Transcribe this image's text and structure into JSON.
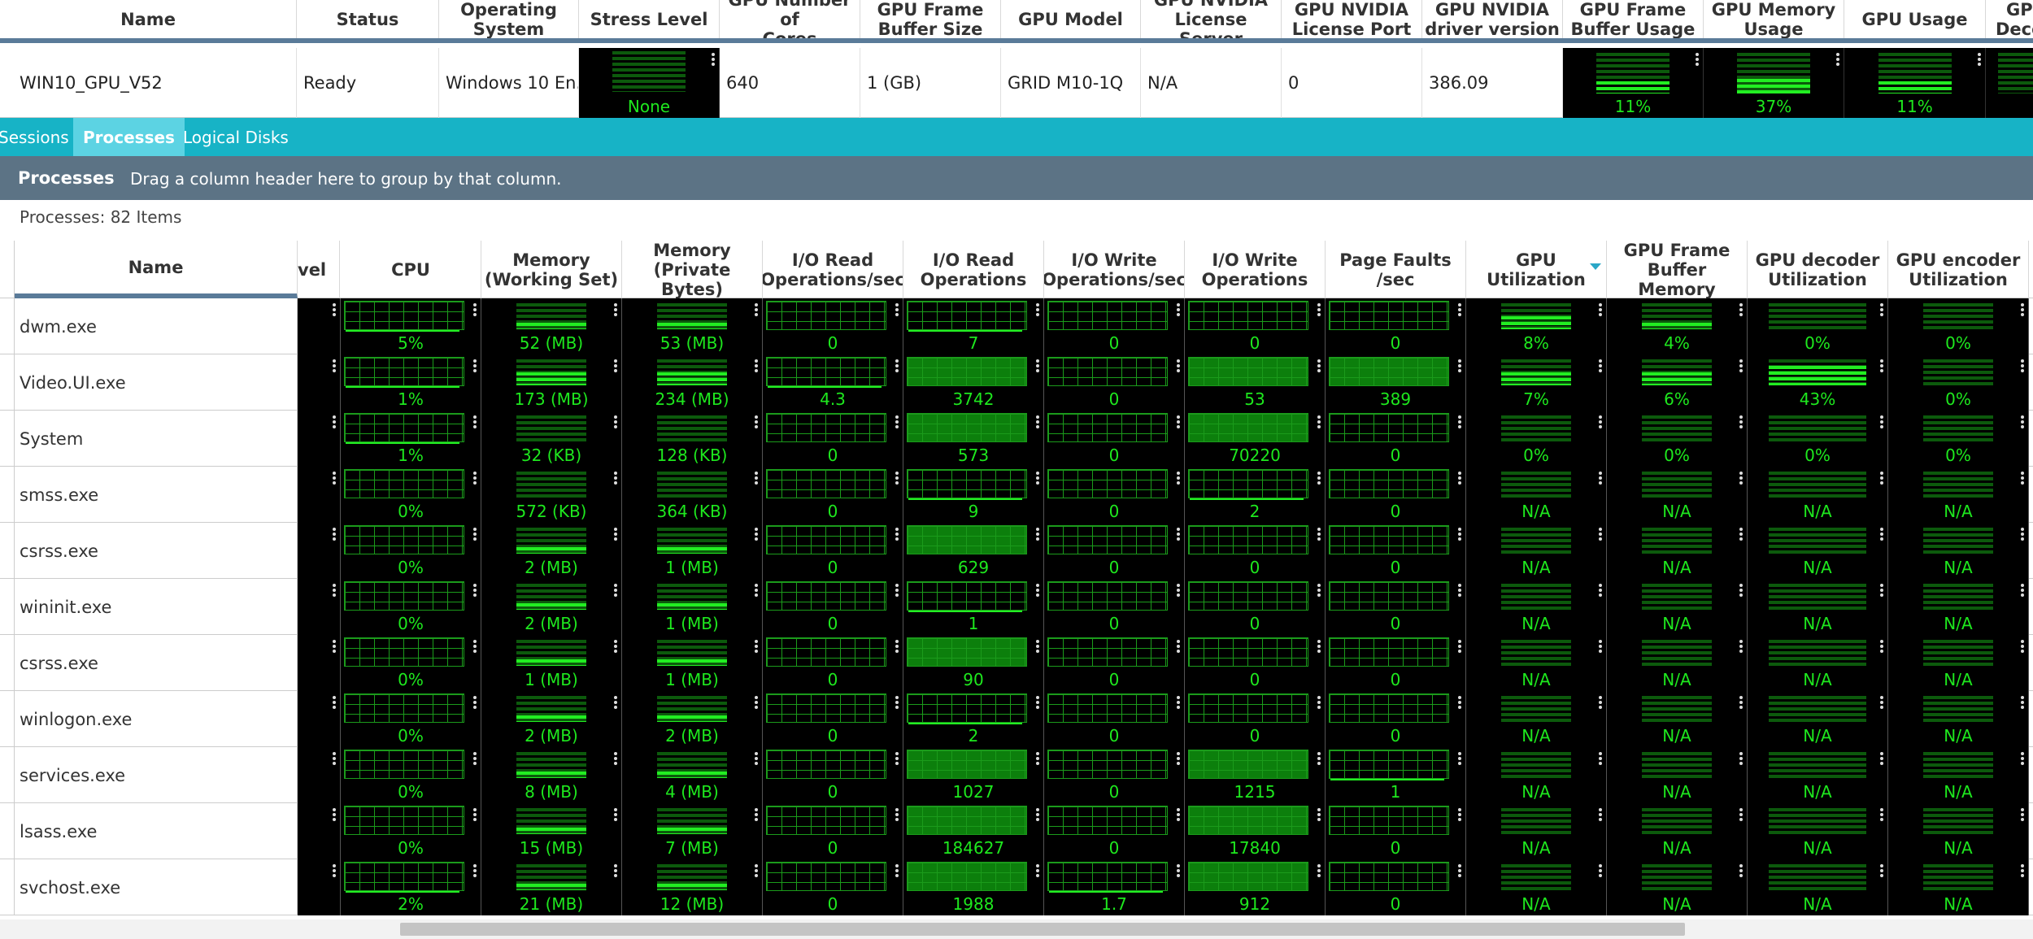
{
  "top": {
    "headers": [
      "Name",
      "Status",
      "Operating\nSystem",
      "Stress Level",
      "GPU Number of\nCores",
      "GPU Frame\nBuffer Size",
      "GPU Model",
      "GPU NVIDIA\nLicense Server",
      "GPU NVIDIA\nLicense Port",
      "GPU NVIDIA\ndriver version",
      "GPU Frame\nBuffer Usage",
      "GPU Memory\nUsage",
      "GPU Usage",
      "GP\nDeco"
    ],
    "row": {
      "name": "WIN10_GPU_V52",
      "status": "Ready",
      "os": "Windows 10 En...",
      "stress": "None",
      "cores": "640",
      "fb_size": "1 (GB)",
      "model": "GRID M10-1Q",
      "lic_server": "N/A",
      "lic_port": "0",
      "driver": "386.09",
      "fb_usage": "11%",
      "fb_usage_level": 0.11,
      "mem_usage": "37%",
      "mem_usage_level": 0.37,
      "gpu_usage": "11%",
      "gpu_usage_level": 0.11
    }
  },
  "tabs": [
    "Sessions",
    "Processes",
    "Logical Disks"
  ],
  "groupbar": {
    "title": "Processes",
    "hint": "Drag a column header here to group by that column."
  },
  "count": "Processes: 82 Items",
  "columns": [
    "Name",
    "vel",
    "CPU",
    "Memory\n(Working Set)",
    "Memory\n(Private Bytes)",
    "I/O Read\nOperations/sec",
    "I/O Read\nOperations",
    "I/O Write\nOperations/sec",
    "I/O Write\nOperations",
    "Page Faults /sec",
    "GPU\nUtilization",
    "GPU Frame\nBuffer Memory",
    "GPU decoder\nUtilization",
    "GPU encoder\nUtilization"
  ],
  "processes": [
    {
      "name": "dwm.exe",
      "cpu": "5%",
      "ws": "52 (MB)",
      "pb": "53 (MB)",
      "iors": "0",
      "ior": "7",
      "iows": "0",
      "iow": "0",
      "pf": "0",
      "gpu": "8%",
      "gpu_l": 0.5,
      "fb": "4%",
      "fb_l": 0.25,
      "dec": "0%",
      "dec_l": 0,
      "enc": "0%",
      "enc_l": 0
    },
    {
      "name": "Video.UI.exe",
      "cpu": "1%",
      "ws": "173 (MB)",
      "pb": "234 (MB)",
      "iors": "4.3",
      "ior": "3742",
      "iows": "0",
      "iow": "53",
      "pf": "389",
      "gpu": "7%",
      "gpu_l": 0.5,
      "fb": "6%",
      "fb_l": 0.5,
      "dec": "43%",
      "dec_l": 0.75,
      "enc": "0%",
      "enc_l": 0
    },
    {
      "name": "System",
      "cpu": "1%",
      "ws": "32 (KB)",
      "pb": "128 (KB)",
      "iors": "0",
      "ior": "573",
      "iows": "0",
      "iow": "70220",
      "pf": "0",
      "gpu": "0%",
      "gpu_l": 0,
      "fb": "0%",
      "fb_l": 0,
      "dec": "0%",
      "dec_l": 0,
      "enc": "0%",
      "enc_l": 0
    },
    {
      "name": "smss.exe",
      "cpu": "0%",
      "ws": "572 (KB)",
      "pb": "364 (KB)",
      "iors": "0",
      "ior": "9",
      "iows": "0",
      "iow": "2",
      "pf": "0",
      "gpu": "N/A",
      "gpu_l": 0,
      "fb": "N/A",
      "fb_l": 0,
      "dec": "N/A",
      "dec_l": 0,
      "enc": "N/A",
      "enc_l": 0
    },
    {
      "name": "csrss.exe",
      "cpu": "0%",
      "ws": "2 (MB)",
      "pb": "1 (MB)",
      "iors": "0",
      "ior": "629",
      "iows": "0",
      "iow": "0",
      "pf": "0",
      "gpu": "N/A",
      "gpu_l": 0,
      "fb": "N/A",
      "fb_l": 0,
      "dec": "N/A",
      "dec_l": 0,
      "enc": "N/A",
      "enc_l": 0
    },
    {
      "name": "wininit.exe",
      "cpu": "0%",
      "ws": "2 (MB)",
      "pb": "1 (MB)",
      "iors": "0",
      "ior": "1",
      "iows": "0",
      "iow": "0",
      "pf": "0",
      "gpu": "N/A",
      "gpu_l": 0,
      "fb": "N/A",
      "fb_l": 0,
      "dec": "N/A",
      "dec_l": 0,
      "enc": "N/A",
      "enc_l": 0
    },
    {
      "name": "csrss.exe",
      "cpu": "0%",
      "ws": "1 (MB)",
      "pb": "1 (MB)",
      "iors": "0",
      "ior": "90",
      "iows": "0",
      "iow": "0",
      "pf": "0",
      "gpu": "N/A",
      "gpu_l": 0,
      "fb": "N/A",
      "fb_l": 0,
      "dec": "N/A",
      "dec_l": 0,
      "enc": "N/A",
      "enc_l": 0
    },
    {
      "name": "winlogon.exe",
      "cpu": "0%",
      "ws": "2 (MB)",
      "pb": "2 (MB)",
      "iors": "0",
      "ior": "2",
      "iows": "0",
      "iow": "0",
      "pf": "0",
      "gpu": "N/A",
      "gpu_l": 0,
      "fb": "N/A",
      "fb_l": 0,
      "dec": "N/A",
      "dec_l": 0,
      "enc": "N/A",
      "enc_l": 0
    },
    {
      "name": "services.exe",
      "cpu": "0%",
      "ws": "8 (MB)",
      "pb": "4 (MB)",
      "iors": "0",
      "ior": "1027",
      "iows": "0",
      "iow": "1215",
      "pf": "1",
      "gpu": "N/A",
      "gpu_l": 0,
      "fb": "N/A",
      "fb_l": 0,
      "dec": "N/A",
      "dec_l": 0,
      "enc": "N/A",
      "enc_l": 0
    },
    {
      "name": "lsass.exe",
      "cpu": "0%",
      "ws": "15 (MB)",
      "pb": "7 (MB)",
      "iors": "0",
      "ior": "184627",
      "iows": "0",
      "iow": "17840",
      "pf": "0",
      "gpu": "N/A",
      "gpu_l": 0,
      "fb": "N/A",
      "fb_l": 0,
      "dec": "N/A",
      "dec_l": 0,
      "enc": "N/A",
      "enc_l": 0
    },
    {
      "name": "svchost.exe",
      "cpu": "2%",
      "ws": "21 (MB)",
      "pb": "12 (MB)",
      "iors": "0",
      "ior": "1988",
      "iows": "1.7",
      "iow": "912",
      "pf": "0",
      "gpu": "N/A",
      "gpu_l": 0,
      "fb": "N/A",
      "fb_l": 0,
      "dec": "N/A",
      "dec_l": 0,
      "enc": "N/A",
      "enc_l": 0
    }
  ],
  "colors": {
    "accent": "#17b3c6",
    "header_bar": "#5c7385",
    "graph_green": "#22ee22",
    "graph_bg": "#000000"
  }
}
